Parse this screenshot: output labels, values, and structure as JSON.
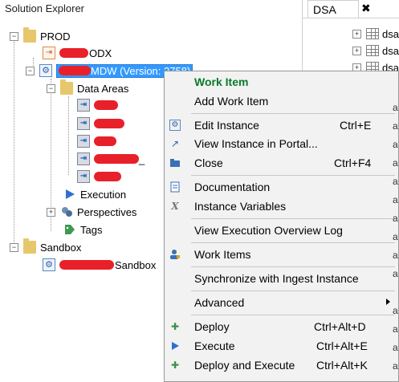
{
  "explorer": {
    "title": "Solution Explorer",
    "prod": "PROD",
    "odx": "ODX",
    "mdw": "MDW (Version: 2758)",
    "data_areas": "Data Areas",
    "execution": "Execution",
    "perspectives": "Perspectives",
    "tags": "Tags",
    "sandbox": "Sandbox",
    "sandbox_child": "Sandbox",
    "data_area_suffix": "_"
  },
  "dsa": {
    "tab_label": "DSA",
    "close": "✖",
    "rows": [
      "dsa",
      "dsa",
      "dsa"
    ],
    "side_letter": "a"
  },
  "menu": {
    "work_item_header": "Work Item",
    "add_work_item": "Add Work Item",
    "edit_instance": "Edit Instance",
    "edit_instance_sc": "Ctrl+E",
    "view_in_portal": "View Instance in Portal...",
    "close": "Close",
    "close_sc": "Ctrl+F4",
    "documentation": "Documentation",
    "instance_variables": "Instance Variables",
    "view_exec_log": "View Execution Overview Log",
    "work_items": "Work Items",
    "sync_ingest": "Synchronize with Ingest Instance",
    "advanced": "Advanced",
    "deploy": "Deploy",
    "deploy_sc": "Ctrl+Alt+D",
    "execute": "Execute",
    "execute_sc": "Ctrl+Alt+E",
    "deploy_execute": "Deploy and Execute",
    "deploy_execute_sc": "Ctrl+Alt+K"
  },
  "colors": {
    "accent_green": "#0a7a2a",
    "selection_blue": "#3399ff",
    "redaction_red": "#e8202a"
  }
}
